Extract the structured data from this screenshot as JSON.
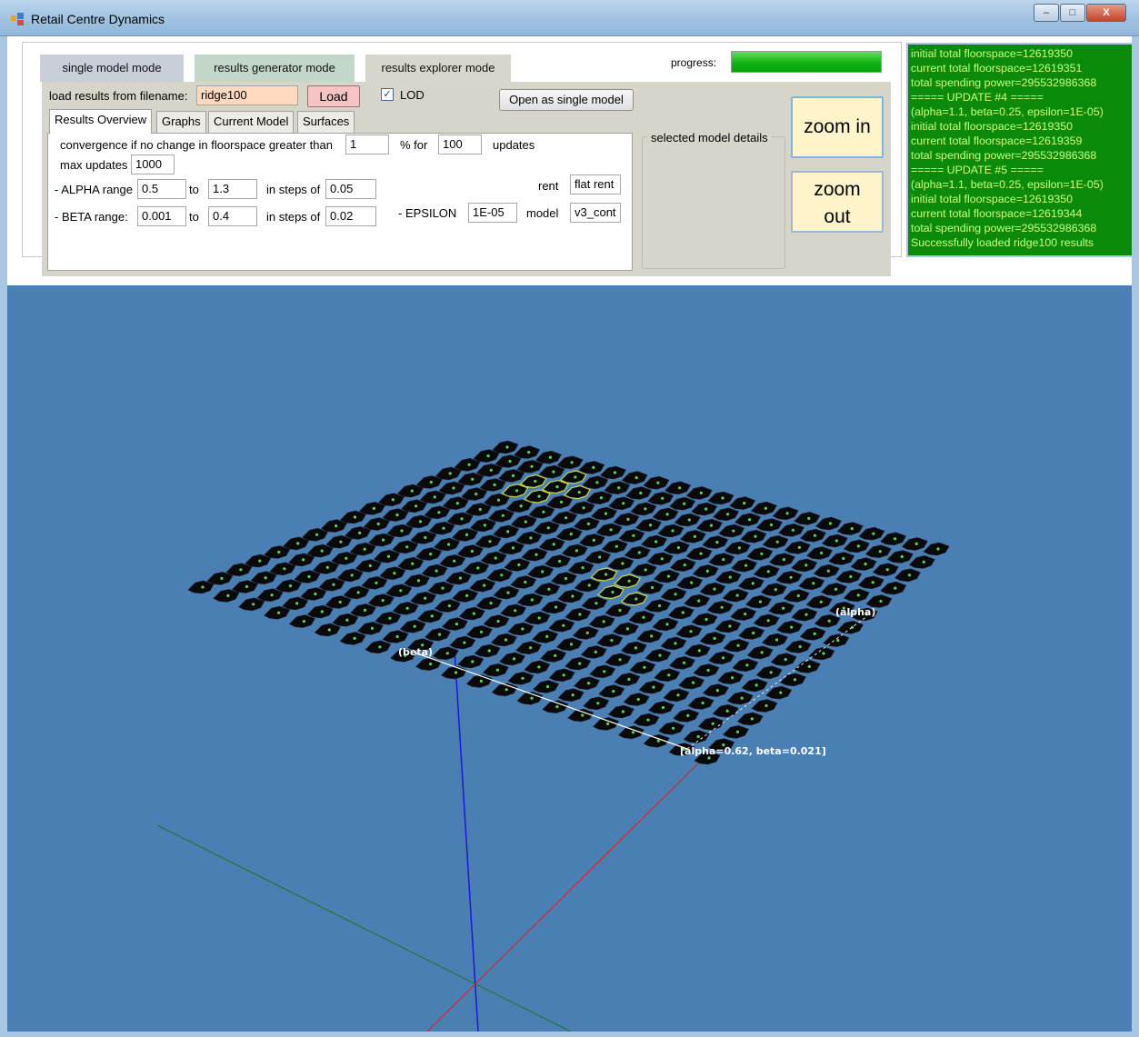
{
  "window": {
    "title": "Retail Centre Dynamics",
    "controls": {
      "minimize": "–",
      "maximize": "□",
      "close": "X"
    }
  },
  "modes": {
    "single": "single model mode",
    "generator": "results generator mode",
    "explorer": "results explorer mode"
  },
  "progress": {
    "label": "progress:",
    "value_percent": 100,
    "color": "#12b312"
  },
  "explorer": {
    "load_label": "load results from filename:",
    "filename": "ridge100",
    "load_button": "Load",
    "lod_label": "LOD",
    "lod_checked_glyph": "✓",
    "open_single_button": "Open as single model",
    "subtabs": [
      "Results Overview",
      "Graphs",
      "Current Model",
      "Surfaces"
    ],
    "overview": {
      "convergence_label": "convergence if no change in floorspace greater than",
      "convergence_value": "1",
      "percent_for_label": "% for",
      "updates_value": "100",
      "updates_label": "updates",
      "max_updates_label": "max updates",
      "max_updates_value": "1000",
      "alpha_label": "- ALPHA range",
      "alpha_from": "0.5",
      "to_label": "to",
      "alpha_to": "1.3",
      "steps_label": "in steps of",
      "alpha_step": "0.05",
      "beta_label": "- BETA range:",
      "beta_from": "0.001",
      "beta_to": "0.4",
      "beta_step": "0.02",
      "rent_label": "rent",
      "rent_value": "flat rent",
      "epsilon_label": "- EPSILON",
      "epsilon_value": "1E-05",
      "model_label": "model",
      "model_value": "v3_cont"
    },
    "selected_details_label": "selected model details",
    "zoom_in": "zoom in",
    "zoom_out_line1": "zoom",
    "zoom_out_line2": "out"
  },
  "log": [
    "initial total floorspace=12619350",
    "current total floorspace=12619351",
    "total spending power=295532986368",
    "===== UPDATE #4 =====",
    "(alpha=1.1, beta=0.25, epsilon=1E-05)",
    "initial total floorspace=12619350",
    "current total floorspace=12619359",
    "total spending power=295532986368",
    "===== UPDATE #5 =====",
    "(alpha=1.1, beta=0.25, epsilon=1E-05)",
    "initial total floorspace=12619350",
    "current total floorspace=12619344",
    "total spending power=295532986368",
    "Successfully loaded ridge100 results"
  ],
  "viewport3d": {
    "background": "#4a7fb3",
    "axis_label_alpha": "(alpha)",
    "axis_label_beta": "(beta)",
    "corner_label": "[alpha=0.62, beta=0.021]",
    "axis_colors": {
      "x": "#d62b2b",
      "y": "#1a1adb",
      "z": "#1f7a2a"
    },
    "grid_rows": 17,
    "grid_cols": 21
  }
}
